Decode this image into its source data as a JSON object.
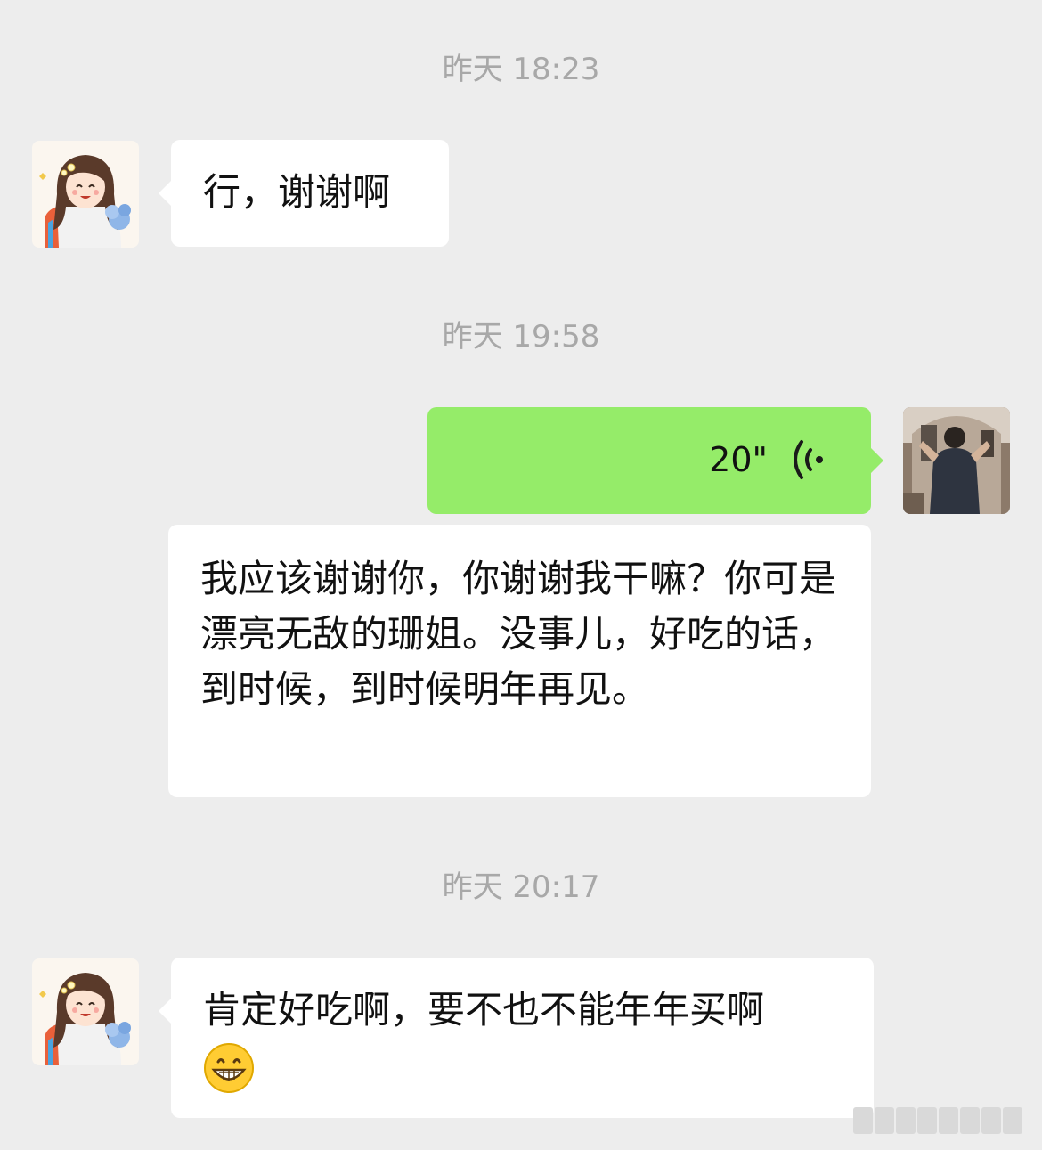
{
  "timestamps": [
    "昨天 18:23",
    "昨天 19:58",
    "昨天 20:17"
  ],
  "messages": {
    "m1": {
      "text": "行，谢谢啊"
    },
    "m2": {
      "type": "voice",
      "duration": "20\""
    },
    "m3": {
      "text": "我应该谢谢你，你谢谢我干嘛？你可是漂亮无敌的珊姐。没事儿，好吃的话，到时候，到时候明年再见。"
    },
    "m4": {
      "text": "肯定好吃啊，要不也不能年年买啊",
      "emoji": "grinning-face-emoji"
    }
  },
  "colors": {
    "background": "#ededed",
    "bubble_white": "#ffffff",
    "bubble_green": "#95ec69",
    "timestamp": "#a8a8a8"
  }
}
